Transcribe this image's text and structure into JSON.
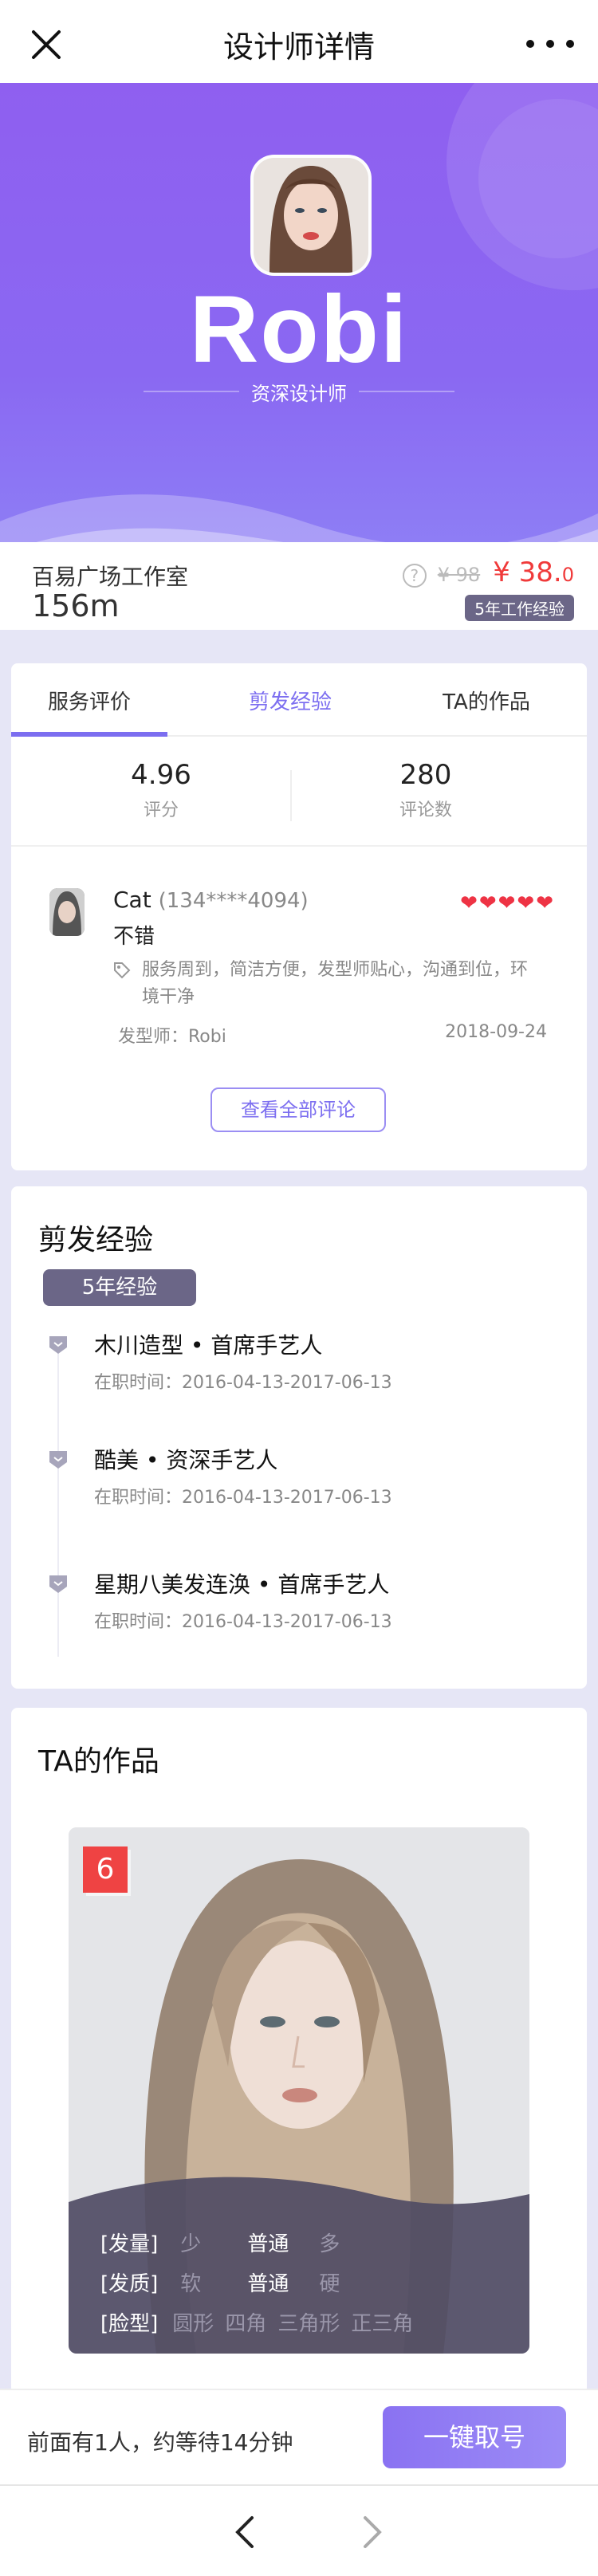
{
  "nav": {
    "title": "设计师详情",
    "close_icon": "close-icon",
    "more_icon": "more-icon"
  },
  "hero": {
    "name": "Robi",
    "role": "资深设计师"
  },
  "info": {
    "studio": "百易广场工作室",
    "distance": "156m",
    "info_icon": "?",
    "old_price": "¥ 98",
    "price_main": "¥ 38.",
    "price_decimal": "0",
    "experience_tag": "5年工作经验"
  },
  "reviews": {
    "tabs": [
      "服务评价",
      "剪发经验",
      "TA的作品"
    ],
    "active_tab_index": 0,
    "highlight_tab_index": 1,
    "rating": "4.96",
    "rating_label": "评分",
    "count": "280",
    "count_label": "评论数",
    "item": {
      "name": "Cat",
      "phone": "(134****4094)",
      "stars": 5,
      "stars_text": "❤❤❤❤❤",
      "text": "不错",
      "tags": "服务周到，简洁方便，发型师贴心，沟通到位，环境干净",
      "stylist": "发型师：Robi",
      "date": "2018-09-24"
    },
    "view_all": "查看全部评论"
  },
  "experience": {
    "title": "剪发经验",
    "badge": "5年经验",
    "items": [
      {
        "title": "木川造型 • 首席手艺人",
        "date": "在职时间：2016-04-13-2017-06-13"
      },
      {
        "title": "酷美 •  资深手艺人",
        "date": "在职时间：2016-04-13-2017-06-13"
      },
      {
        "title": "星期八美发连涣 • 首席手艺人",
        "date": "在职时间：2016-04-13-2017-06-13"
      }
    ]
  },
  "works": {
    "title": "TA的作品",
    "badge": "6",
    "attributes": [
      {
        "label": "[发量]",
        "options": [
          "少",
          "普通",
          "多"
        ],
        "selected": 1
      },
      {
        "label": "[发质]",
        "options": [
          "软",
          "普通",
          "硬"
        ],
        "selected": 1
      },
      {
        "label": "[脸型]",
        "options": [
          "圆形",
          "四角",
          "三角形",
          "正三角"
        ],
        "selected": -1
      }
    ]
  },
  "bottom": {
    "wait_text": "前面有1人，约等待14分钟",
    "button": "一键取号"
  },
  "browser": {
    "back_icon": "chevron-left-icon",
    "forward_icon": "chevron-right-icon"
  },
  "colors": {
    "accent": "#7c6ef0",
    "price": "#f03a3a",
    "tag": "#6b6687",
    "heart": "#ee3344"
  }
}
